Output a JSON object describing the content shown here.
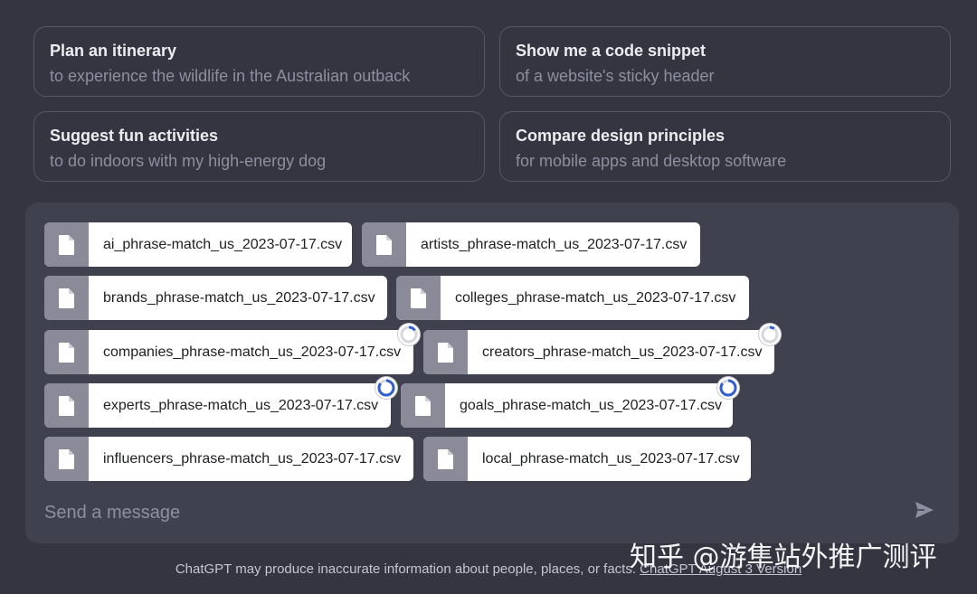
{
  "suggestions": [
    {
      "title": "Plan an itinerary",
      "subtitle": "to experience the wildlife in the Australian outback"
    },
    {
      "title": "Show me a code snippet",
      "subtitle": "of a website's sticky header"
    },
    {
      "title": "Suggest fun activities",
      "subtitle": "to do indoors with my high-energy dog"
    },
    {
      "title": "Compare design principles",
      "subtitle": "for mobile apps and desktop software"
    }
  ],
  "files": [
    {
      "name": "ai_phrase-match_us_2023-07-17.csv",
      "status": "uploaded",
      "icon": "file-icon"
    },
    {
      "name": "artists_phrase-match_us_2023-07-17.csv",
      "status": "uploaded",
      "icon": "file-icon"
    },
    {
      "name": "brands_phrase-match_us_2023-07-17.csv",
      "status": "uploaded",
      "icon": "file-icon"
    },
    {
      "name": "colleges_phrase-match_us_2023-07-17.csv",
      "status": "uploaded",
      "icon": "file-icon"
    },
    {
      "name": "companies_phrase-match_us_2023-07-17.csv",
      "status": "uploading",
      "progress": 0.15,
      "icon": "file-icon"
    },
    {
      "name": "creators_phrase-match_us_2023-07-17.csv",
      "status": "uploading",
      "progress": 0.1,
      "icon": "file-icon"
    },
    {
      "name": "experts_phrase-match_us_2023-07-17.csv",
      "status": "uploading",
      "progress": 0.85,
      "icon": "file-icon"
    },
    {
      "name": "goals_phrase-match_us_2023-07-17.csv",
      "status": "uploading",
      "progress": 0.85,
      "icon": "file-icon"
    },
    {
      "name": "influencers_phrase-match_us_2023-07-17.csv",
      "status": "uploaded",
      "icon": "file-icon"
    },
    {
      "name": "local_phrase-match_us_2023-07-17.csv",
      "status": "uploaded",
      "icon": "file-icon"
    }
  ],
  "composer": {
    "placeholder": "Send a message",
    "send_icon": "send-icon"
  },
  "footer": {
    "text": "ChatGPT may produce inaccurate information about people, places, or facts.",
    "link": "ChatGPT August 3 Version"
  },
  "watermark": "知乎 @游隼站外推广测评",
  "colors": {
    "background": "#343541",
    "composer": "#40414f",
    "spinner": "#2f5fd0"
  }
}
